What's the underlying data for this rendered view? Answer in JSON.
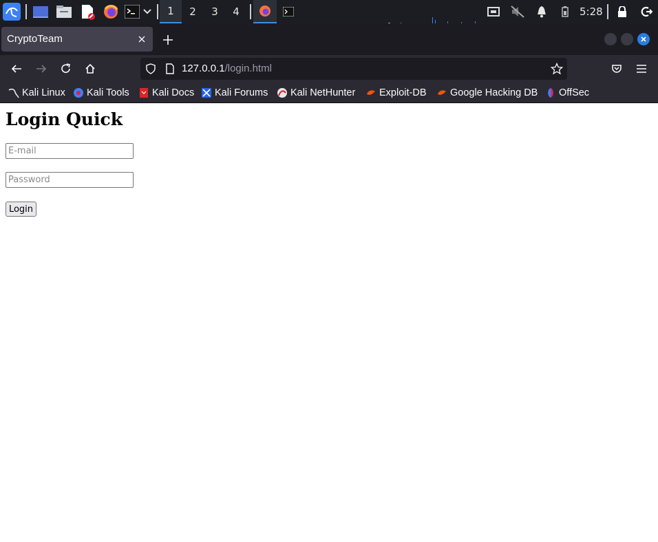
{
  "taskbar": {
    "workspaces": [
      "1",
      "2",
      "3",
      "4"
    ],
    "active_workspace": "1",
    "clock": "5:28"
  },
  "browser": {
    "tab_title": "CryptoTeam",
    "url_host": "127.0.0.1",
    "url_path": "/login.html"
  },
  "bookmarks": [
    {
      "label": "Kali Linux",
      "icon": "kali-dragon-icon"
    },
    {
      "label": "Kali Tools",
      "icon": "kali-tools-icon"
    },
    {
      "label": "Kali Docs",
      "icon": "kali-docs-icon"
    },
    {
      "label": "Kali Forums",
      "icon": "kali-forums-icon"
    },
    {
      "label": "Kali NetHunter",
      "icon": "kali-nethunter-icon"
    },
    {
      "label": "Exploit-DB",
      "icon": "exploit-db-icon"
    },
    {
      "label": "Google Hacking DB",
      "icon": "ghdb-icon"
    },
    {
      "label": "OffSec",
      "icon": "offsec-icon"
    }
  ],
  "page": {
    "heading": "Login Quick",
    "email_placeholder": "E-mail",
    "password_placeholder": "Password",
    "login_button": "Login"
  },
  "colors": {
    "taskbar_bg": "#1b1d22",
    "browser_chrome": "#2b2a33",
    "accent": "#3d8ee9"
  }
}
